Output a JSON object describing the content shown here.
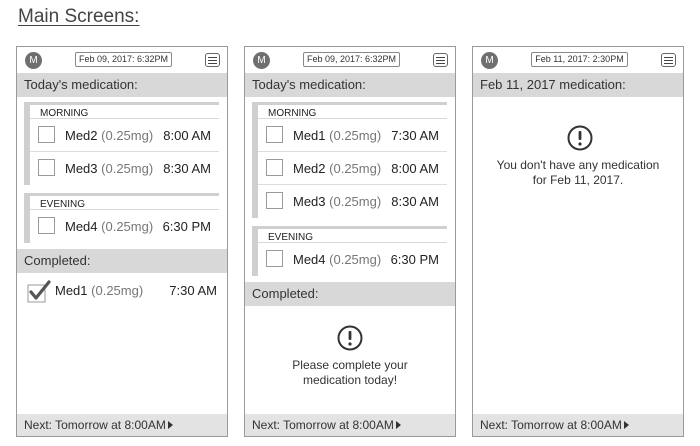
{
  "page_title": "Main Screens:",
  "avatar_letter": "M",
  "screens": [
    {
      "date": "Feb 09, 2017: 6:32PM",
      "heading": "Today's medication:",
      "groups": [
        {
          "title": "MORNING",
          "rows": [
            {
              "name": "Med2",
              "dose": "(0.25mg)",
              "time": "8:00 AM"
            },
            {
              "name": "Med3",
              "dose": "(0.25mg)",
              "time": "8:30 AM"
            }
          ]
        },
        {
          "title": "EVENING",
          "rows": [
            {
              "name": "Med4",
              "dose": "(0.25mg)",
              "time": "6:30 PM"
            }
          ]
        }
      ],
      "completed_label": "Completed:",
      "completed": [
        {
          "name": "Med1",
          "dose": "(0.25mg)",
          "time": "7:30 AM"
        }
      ],
      "footer": "Next: Tomorrow at 8:00AM"
    },
    {
      "date": "Feb 09, 2017: 6:32PM",
      "heading": "Today's medication:",
      "groups": [
        {
          "title": "MORNING",
          "rows": [
            {
              "name": "Med1",
              "dose": "(0.25mg)",
              "time": "7:30 AM"
            },
            {
              "name": "Med2",
              "dose": "(0.25mg)",
              "time": "8:00 AM"
            },
            {
              "name": "Med3",
              "dose": "(0.25mg)",
              "time": "8:30 AM"
            }
          ]
        },
        {
          "title": "EVENING",
          "rows": [
            {
              "name": "Med4",
              "dose": "(0.25mg)",
              "time": "6:30 PM"
            }
          ]
        }
      ],
      "completed_label": "Completed:",
      "message_line1": "Please complete your",
      "message_line2": "medication today!",
      "footer": "Next: Tomorrow at 8:00AM"
    },
    {
      "date": "Feb 11, 2017: 2:30PM",
      "heading": "Feb 11, 2017 medication:",
      "message_line1": "You don't have any medication",
      "message_line2": "for Feb 11, 2017.",
      "footer": "Next: Tomorrow at 8:00AM"
    }
  ]
}
